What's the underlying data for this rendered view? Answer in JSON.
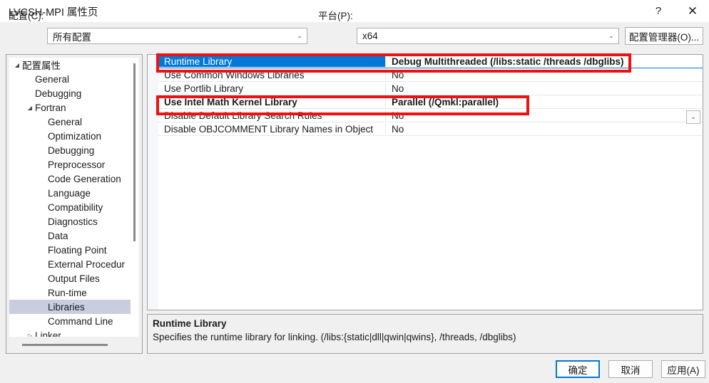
{
  "window": {
    "title": "LVCSH-MPI 属性页",
    "help_label": "?",
    "close_label": "✕"
  },
  "config_bar": {
    "configuration_label": "配置(C):",
    "configuration_value": "所有配置",
    "platform_label": "平台(P):",
    "platform_value": "x64",
    "config_manager_button": "配置管理器(O)...",
    "chevron": "⌄"
  },
  "tree": {
    "items": [
      {
        "label": "配置属性",
        "indent": 0,
        "glyph": "◢",
        "selected": false
      },
      {
        "label": "General",
        "indent": 1,
        "glyph": "",
        "selected": false
      },
      {
        "label": "Debugging",
        "indent": 1,
        "glyph": "",
        "selected": false
      },
      {
        "label": "Fortran",
        "indent": 1,
        "glyph": "◢",
        "selected": false
      },
      {
        "label": "General",
        "indent": 2,
        "glyph": "",
        "selected": false
      },
      {
        "label": "Optimization",
        "indent": 2,
        "glyph": "",
        "selected": false
      },
      {
        "label": "Debugging",
        "indent": 2,
        "glyph": "",
        "selected": false
      },
      {
        "label": "Preprocessor",
        "indent": 2,
        "glyph": "",
        "selected": false
      },
      {
        "label": "Code Generation",
        "indent": 2,
        "glyph": "",
        "selected": false
      },
      {
        "label": "Language",
        "indent": 2,
        "glyph": "",
        "selected": false
      },
      {
        "label": "Compatibility",
        "indent": 2,
        "glyph": "",
        "selected": false
      },
      {
        "label": "Diagnostics",
        "indent": 2,
        "glyph": "",
        "selected": false
      },
      {
        "label": "Data",
        "indent": 2,
        "glyph": "",
        "selected": false
      },
      {
        "label": "Floating Point",
        "indent": 2,
        "glyph": "",
        "selected": false
      },
      {
        "label": "External Procedur",
        "indent": 2,
        "glyph": "",
        "selected": false
      },
      {
        "label": "Output Files",
        "indent": 2,
        "glyph": "",
        "selected": false
      },
      {
        "label": "Run-time",
        "indent": 2,
        "glyph": "",
        "selected": false
      },
      {
        "label": "Libraries",
        "indent": 2,
        "glyph": "",
        "selected": true
      },
      {
        "label": "Command Line",
        "indent": 2,
        "glyph": "",
        "selected": false
      },
      {
        "label": "Linker",
        "indent": 1,
        "glyph": "▷",
        "selected": false
      }
    ]
  },
  "grid": {
    "rows": [
      {
        "name": "Runtime Library",
        "value": "Debug Multithreaded (/libs:static /threads /dbglibs)",
        "selected": true,
        "modified": true
      },
      {
        "name": "Use Common Windows Libraries",
        "value": "No",
        "selected": false,
        "modified": false
      },
      {
        "name": "Use Portlib Library",
        "value": "No",
        "selected": false,
        "modified": false
      },
      {
        "name": "Use Intel Math Kernel Library",
        "value": "Parallel (/Qmkl:parallel)",
        "selected": false,
        "modified": true
      },
      {
        "name": "Disable Default Library Search Rules",
        "value": "No",
        "selected": false,
        "modified": false
      },
      {
        "name": "Disable OBJCOMMENT Library Names in Object",
        "value": "No",
        "selected": false,
        "modified": false
      }
    ],
    "dropdown_chevron": "⌄"
  },
  "description": {
    "title": "Runtime Library",
    "text": "Specifies the runtime library for linking. (/libs:{static|dll|qwin|qwins}, /threads, /dbglibs)"
  },
  "footer": {
    "ok_label": "确定",
    "cancel_label": "取消",
    "apply_label": "应用(A)"
  },
  "annotations": {
    "color": "#ee1111",
    "boxes": [
      {
        "target": "Runtime Library row"
      },
      {
        "target": "Use Intel Math Kernel Library row"
      }
    ]
  }
}
